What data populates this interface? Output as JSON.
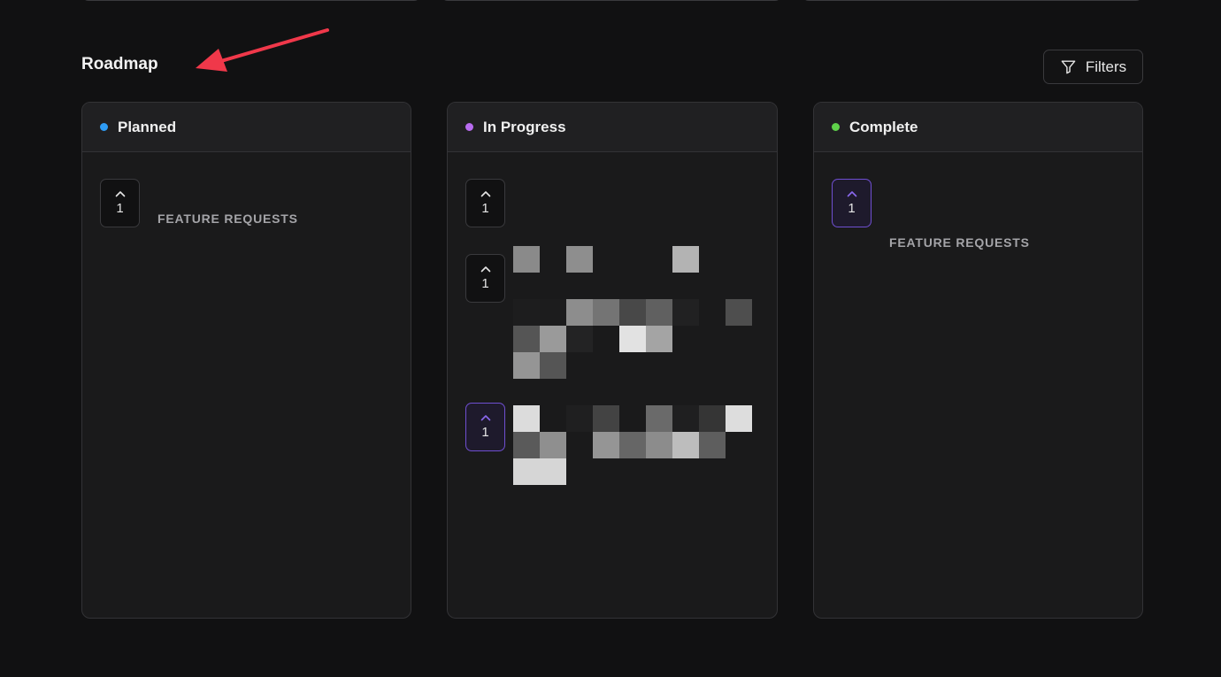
{
  "page": {
    "title": "Roadmap",
    "filters_label": "Filters"
  },
  "colors": {
    "planned": "#2e9cf5",
    "in_progress": "#b86cf0",
    "complete": "#5fd14a",
    "accent": "#6f4fd1"
  },
  "columns": [
    {
      "title": "Planned",
      "items": [
        {
          "votes": "1",
          "category": "FEATURE REQUESTS",
          "voted": false
        }
      ]
    },
    {
      "title": "In Progress",
      "items": [
        {
          "votes": "1",
          "voted": false
        },
        {
          "votes": "1",
          "voted": false
        },
        {
          "votes": "1",
          "voted": true
        }
      ]
    },
    {
      "title": "Complete",
      "items": [
        {
          "votes": "1",
          "category": "FEATURE REQUESTS",
          "voted": true
        }
      ]
    }
  ]
}
